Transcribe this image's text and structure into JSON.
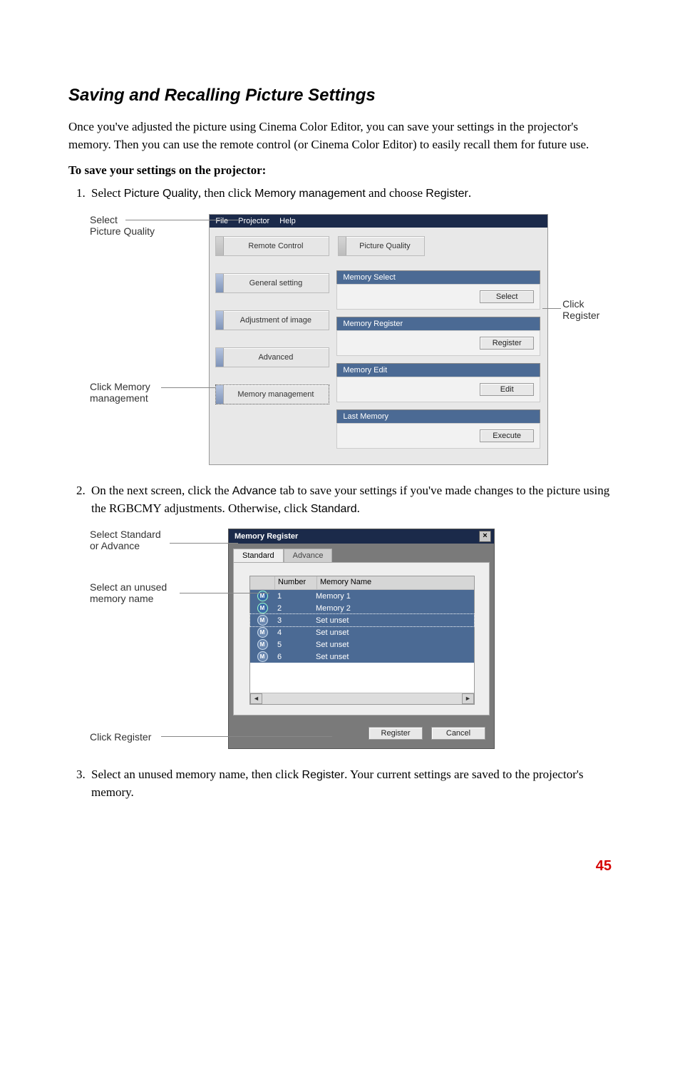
{
  "heading": "Saving and Recalling Picture Settings",
  "intro": "Once you've adjusted the picture using Cinema Color Editor, you can save your settings in the projector's memory. Then you can use the remote control (or Cinema Color Editor) to easily recall them for future use.",
  "lead": "To save your settings on the projector:",
  "step1_pre": "Select ",
  "step1_pq": "Picture Quality",
  "step1_mid": ", then click ",
  "step1_mm": "Memory management",
  "step1_mid2": " and choose ",
  "step1_reg": "Register",
  "step1_end": ".",
  "anno_select": "Select",
  "anno_pq": "Picture Quality",
  "anno_click": "Click",
  "anno_register": "Register",
  "anno_click_mem": "Click Memory",
  "anno_mgmt": "management",
  "menu": {
    "file": "File",
    "projector": "Projector",
    "help": "Help"
  },
  "side": {
    "remote": "Remote Control",
    "pq": "Picture Quality",
    "general": "General setting",
    "adjust": "Adjustment of image",
    "advanced": "Advanced",
    "memmgmt": "Memory management"
  },
  "panels": {
    "memsel": "Memory Select",
    "memreg": "Memory Register",
    "memedit": "Memory Edit",
    "lastmem": "Last Memory",
    "select": "Select",
    "register": "Register",
    "edit": "Edit",
    "execute": "Execute"
  },
  "step2_pre": "On the next screen, click the ",
  "step2_adv": "Advance",
  "step2_mid": " tab to save your settings if you've made changes to the picture using the RGBCMY adjustments. Otherwise, click ",
  "step2_std": "Standard",
  "step2_end": ".",
  "anno2_select": "Select Standard",
  "anno2_or": "or Advance",
  "anno2_unused1": "Select an unused",
  "anno2_unused2": "memory name",
  "anno2_clickreg": "Click Register",
  "dialog": {
    "title": "Memory Register",
    "x": "x",
    "tab_std": "Standard",
    "tab_adv": "Advance",
    "col_num": "Number",
    "col_name": "Memory Name",
    "rows": [
      {
        "n": "1",
        "name": "Memory 1",
        "used": true
      },
      {
        "n": "2",
        "name": "Memory 2",
        "used": true
      },
      {
        "n": "3",
        "name": "Set unset",
        "used": false,
        "sel": true
      },
      {
        "n": "4",
        "name": "Set unset",
        "used": false
      },
      {
        "n": "5",
        "name": "Set unset",
        "used": false
      },
      {
        "n": "6",
        "name": "Set unset",
        "used": false
      }
    ],
    "btn_register": "Register",
    "btn_cancel": "Cancel"
  },
  "step3_pre": "Select an unused memory name, then click ",
  "step3_reg": "Register",
  "step3_end": ". Your current settings are saved to the projector's memory.",
  "page_number": "45"
}
